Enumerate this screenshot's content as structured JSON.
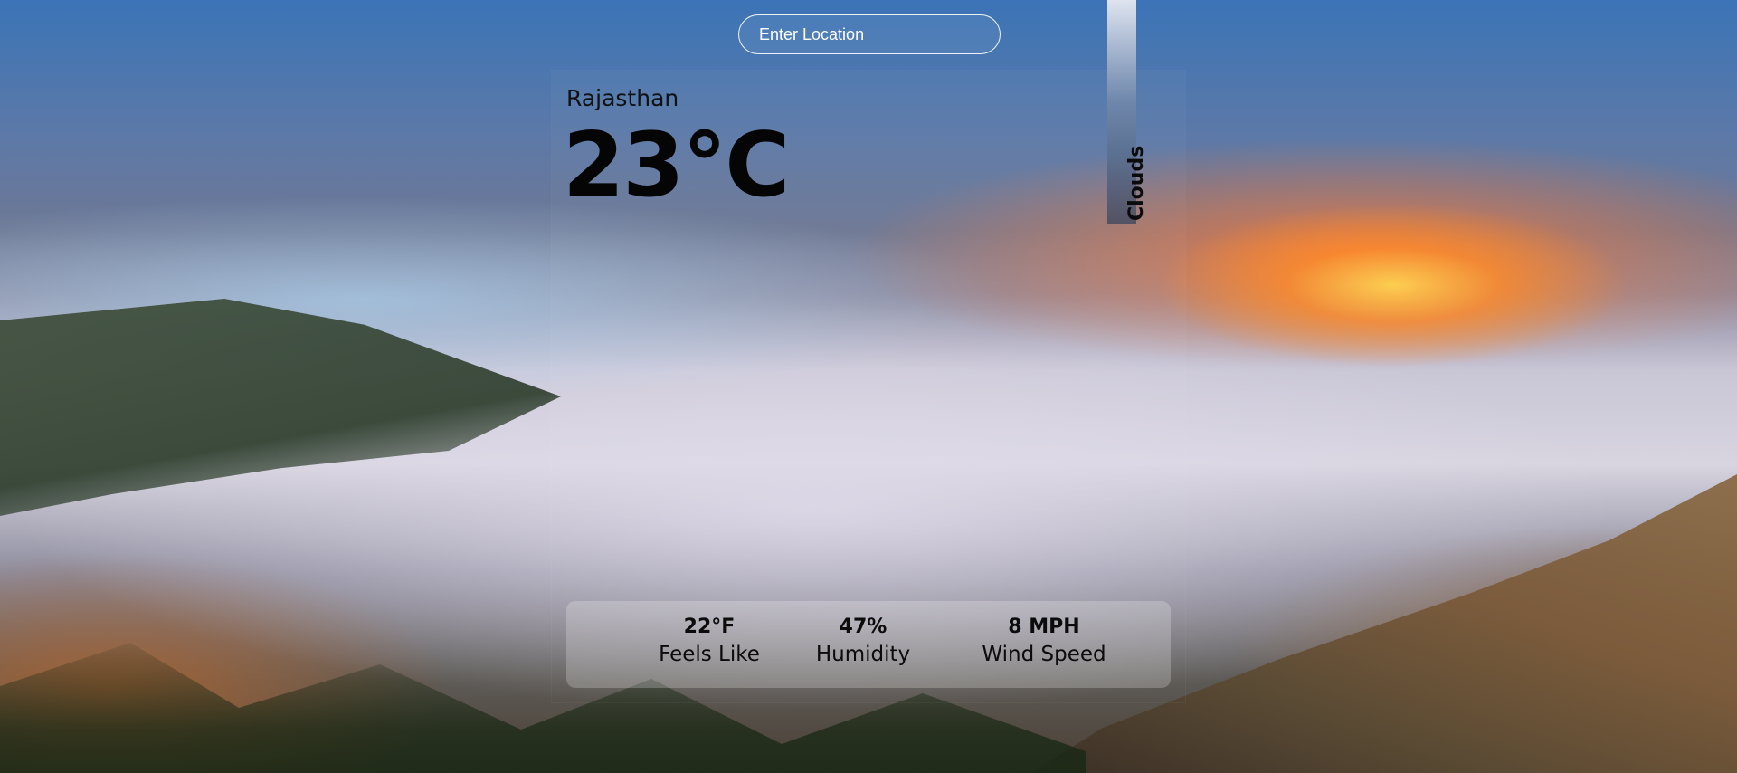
{
  "search": {
    "placeholder": "Enter Location"
  },
  "weather": {
    "location": "Rajasthan",
    "temperature": "23°C",
    "condition": "Clouds",
    "stats": [
      {
        "value": "22°F",
        "label": "Feels Like"
      },
      {
        "value": "47%",
        "label": "Humidity"
      },
      {
        "value": "8 MPH",
        "label": "Wind Speed"
      }
    ]
  },
  "icons": {
    "background": "sunset-over-clouds-landscape-image"
  },
  "colors": {
    "text_dark": "#0b0b0b",
    "input_border": "#ffffff",
    "sunset_orange": "#ff8a2a",
    "sky_blue": "#3b74b7"
  }
}
